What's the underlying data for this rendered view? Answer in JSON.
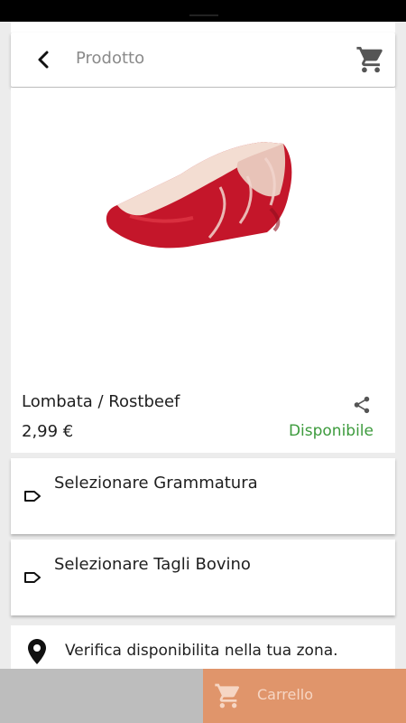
{
  "header": {
    "title": "Prodotto",
    "back_icon": "chevron-left-icon",
    "cart_icon": "shopping-cart-icon"
  },
  "product": {
    "name": "Lombata / Rostbeef",
    "price": "2,99 €",
    "availability": "Disponibile",
    "share_icon": "share-icon",
    "image": "meat-cut-image"
  },
  "options": [
    {
      "label": "Selezionare Grammatura",
      "icon": "tag-icon"
    },
    {
      "label": "Selezionare Tagli Bovino",
      "icon": "tag-icon"
    }
  ],
  "zone": {
    "label": "Verifica disponibilita nella tua zona.",
    "icon": "location-pin-icon"
  },
  "bottom": {
    "cart_label": "Carrello",
    "cart_icon": "shopping-cart-icon"
  },
  "colors": {
    "available": "#3d9b3d",
    "cart_button": "#e0956b",
    "disabled_button": "#bdbdbd"
  }
}
